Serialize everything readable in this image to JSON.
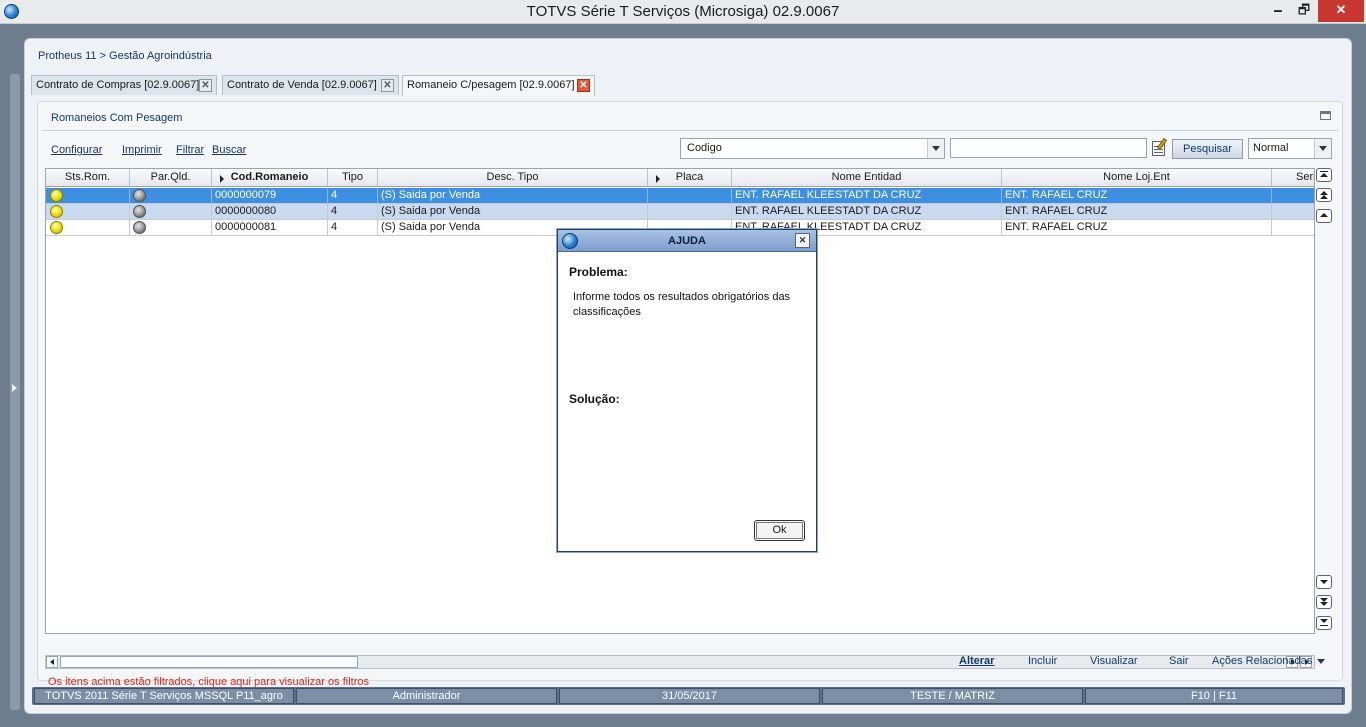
{
  "window": {
    "title": "TOTVS Série T Serviços (Microsiga) 02.9.0067",
    "minimize_glyph": "🗕",
    "maximize_glyph": "🗗",
    "close_glyph": "✕"
  },
  "breadcrumb": "Protheus 11 > Gestão Agroindústria",
  "tabs": [
    {
      "label": "Contrato de Compras [02.9.0067]",
      "active": false
    },
    {
      "label": "Contrato de Venda [02.9.0067]",
      "active": false
    },
    {
      "label": "Romaneio C/pesagem [02.9.0067]",
      "active": true
    }
  ],
  "tab_close_glyph": "✕",
  "section_title": "Romaneios Com Pesagem",
  "toolbar": {
    "links": [
      "Configurar",
      "Imprimir",
      "Filtrar",
      "Buscar"
    ],
    "search_field_value": "Codigo",
    "search_input_value": "",
    "search_button": "Pesquisar",
    "view_mode_value": "Normal"
  },
  "grid": {
    "columns": [
      "Sts.Rom.",
      "Par.Qld.",
      "Cod.Romaneio",
      "Tipo",
      "Desc. Tipo",
      "Placa",
      "Nome Entidad",
      "Nome Loj.Ent",
      "Serie"
    ],
    "sorted_column": "Cod.Romaneio",
    "rows": [
      {
        "sts": "yellow",
        "par": "gray",
        "cod": "0000000079",
        "tipo": "4",
        "desc": "(S) Saida por Venda",
        "placa": "",
        "entidad": "ENT. RAFAEL KLEESTADT DA CRUZ",
        "loj": "ENT. RAFAEL CRUZ",
        "serie": ""
      },
      {
        "sts": "yellow",
        "par": "gray",
        "cod": "0000000080",
        "tipo": "4",
        "desc": "(S) Saida por Venda",
        "placa": "",
        "entidad": "ENT. RAFAEL KLEESTADT DA CRUZ",
        "loj": "ENT. RAFAEL CRUZ",
        "serie": ""
      },
      {
        "sts": "yellow",
        "par": "gray",
        "cod": "0000000081",
        "tipo": "4",
        "desc": "(S) Saida por Venda",
        "placa": "",
        "entidad": "ENT. RAFAEL KLEESTADT DA CRUZ",
        "loj": "ENT. RAFAEL CRUZ",
        "serie": ""
      }
    ],
    "selected_row": 1
  },
  "filter_note": "Os itens acima estão filtrados, clique aqui para visualizar os filtros",
  "actions": {
    "primary": "Alterar",
    "items": [
      "Incluir",
      "Visualizar",
      "Sair",
      "Ações Relacionadas"
    ]
  },
  "statusbar": [
    "TOTVS 2011 Série T Serviços MSSQL P11_agro",
    "Administrador",
    "31/05/2017",
    "TESTE / MATRIZ",
    "F10 | F11"
  ],
  "dialog": {
    "title": "AJUDA",
    "close_glyph": "✕",
    "problem_label": "Problema:",
    "problem_text": "Informe todos os resultados obrigatórios das classificações",
    "solution_label": "Solução:",
    "solution_text": "",
    "ok_label": "Ok"
  }
}
